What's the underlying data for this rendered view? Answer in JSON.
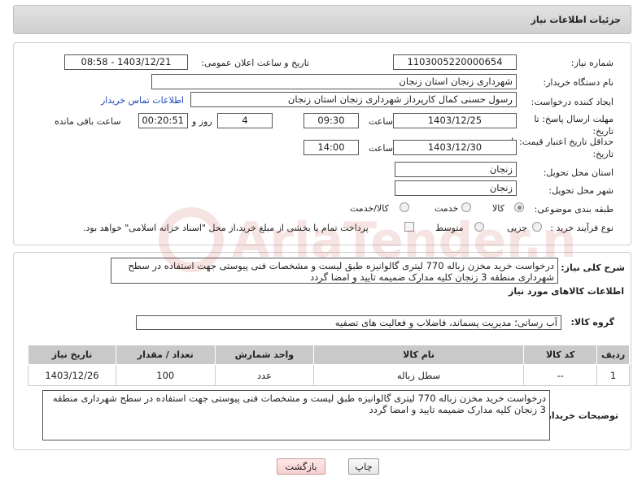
{
  "header": {
    "title": "جزئیات اطلاعات نیاز"
  },
  "form": {
    "need_number": {
      "label": "شماره نیاز:",
      "value": "1103005220000654"
    },
    "announce_datetime": {
      "label": "تاریخ و ساعت اعلان عمومی:",
      "value": "1403/12/21 - 08:58"
    },
    "buyer_org": {
      "label": "نام دستگاه خریدار:",
      "value": "شهرداری زنجان استان زنجان"
    },
    "requester": {
      "label": "ایجاد کننده درخواست:",
      "value": "رسول حسنی کمال کارپرداز شهرداری زنجان استان زنجان",
      "contact_link": "اطلاعات تماس خریدار"
    },
    "reply_deadline": {
      "label_line1": "مهلت ارسال پاسخ: تا",
      "label_line2": "تاریخ:",
      "date": "1403/12/25",
      "time_label": "ساعت",
      "time": "09:30",
      "days": "4",
      "days_label": "روز و",
      "remaining": "00:20:51",
      "remaining_label": "ساعت باقی مانده"
    },
    "price_validity": {
      "label_line1": "حداقل تاریخ اعتبار قیمت: تا",
      "label_line2": "تاریخ:",
      "date": "1403/12/30",
      "time_label": "ساعت",
      "time": "14:00"
    },
    "delivery_province": {
      "label": "استان محل تحویل:",
      "value": "زنجان"
    },
    "delivery_city": {
      "label": "شهر محل تحویل:",
      "value": "زنجان"
    },
    "category": {
      "label": "طبقه بندی موضوعی:",
      "options": [
        "کالا",
        "خدمت",
        "کالا/خدمت"
      ],
      "selected": "کالا"
    },
    "purchase_type": {
      "label": "نوع فرآیند خرید :",
      "options": [
        "جزیی",
        "متوسط"
      ],
      "selected": "",
      "payment_note": "پرداخت تمام یا بخشی از مبلغ خرید،از محل \"اسناد خزانه اسلامی\" خواهد بود."
    }
  },
  "summary": {
    "label": "شرح کلی نیاز:",
    "text": "درخواست خرید مخزن زباله 770 لیتری گالوانیزه طبق لیست و مشخصات فنی پیوستی جهت استفاده در سطح شهرداری منطقه 3 زنجان کلیه مدارک ضمیمه تایید و امضا گردد"
  },
  "goods_section": {
    "title": "اطلاعات کالاهای مورد نیاز",
    "group_label": "گروه کالا:",
    "group_value": "آب رسانی؛ مدیریت پسماند، فاضلاب و فعالیت های تصفیه"
  },
  "table": {
    "headers": [
      "ردیف",
      "کد کالا",
      "نام کالا",
      "واحد شمارش",
      "تعداد / مقدار",
      "تاریخ نیاز"
    ],
    "rows": [
      [
        "1",
        "--",
        "سطل زباله",
        "عدد",
        "100",
        "1403/12/26"
      ]
    ]
  },
  "buyer_notes": {
    "label": "توضیحات خریدار:",
    "text": "درخواست خرید مخزن زباله 770 لیتری گالوانیزه طبق لیست و مشخصات فنی پیوستی جهت استفاده در سطح شهرداری منطقه 3 زنجان کلیه مدارک ضمیمه تایید و امضا گردد"
  },
  "buttons": {
    "print": "چاپ",
    "back": "بازگشت"
  },
  "watermark": "AriaTender.neT"
}
